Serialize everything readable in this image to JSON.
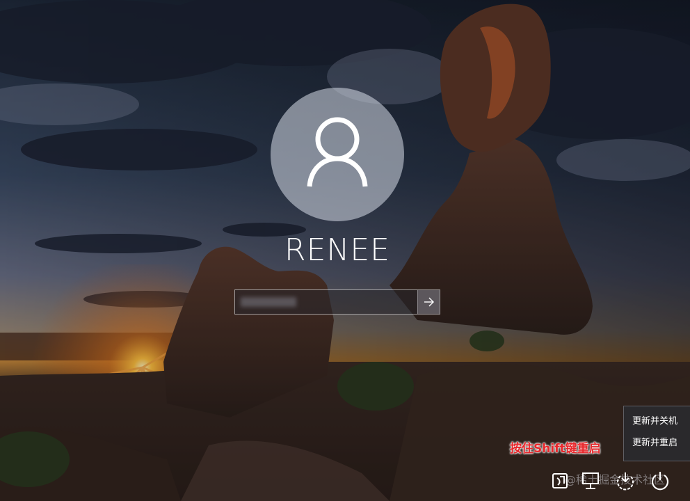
{
  "user": {
    "name": "RENEE"
  },
  "password": {
    "placeholder": "",
    "submit_icon": "arrow-right-icon"
  },
  "power_menu": {
    "items": [
      {
        "label": "更新并关机"
      },
      {
        "label": "更新并重启"
      }
    ]
  },
  "hint": {
    "text": "按住Shift键重启"
  },
  "system_icons": [
    {
      "icon": "ease-of-access-icon"
    },
    {
      "icon": "network-icon"
    },
    {
      "icon": "update-power-icon"
    },
    {
      "icon": "power-icon"
    }
  ],
  "watermark": {
    "text": "@稀土掘金技术社区"
  },
  "colors": {
    "hint_red": "#e8272b",
    "menu_bg": "#2a2a2e"
  }
}
